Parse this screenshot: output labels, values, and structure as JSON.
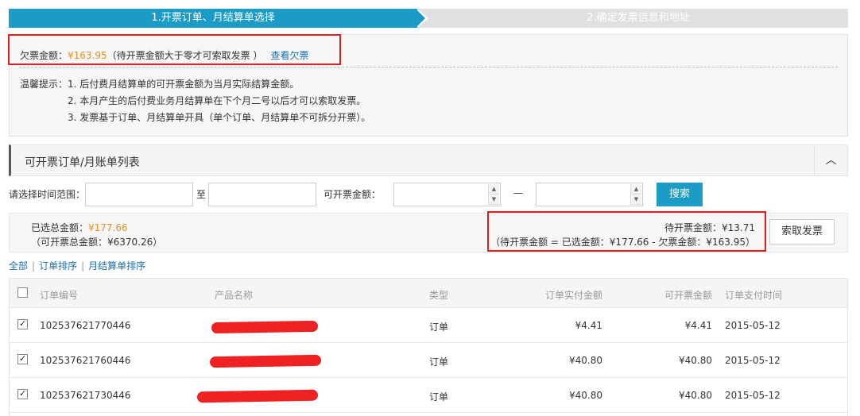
{
  "steps": {
    "active": "1.开票订单、月结算单选择",
    "inactive": "2.确定发票信息和地址"
  },
  "notice": {
    "owed_label": "欠票金额：",
    "owed_amount": "¥163.95",
    "owed_note": "（待开票金额大于零才可索取发票 ）",
    "owed_link": "查看欠票",
    "tips_label": "温馨提示：",
    "tips": [
      "1. 后付费月结算单的可开票金额为当月实际结算金额。",
      "2. 本月产生的后付费业务月结算单在下个月二号以后才可以索取发票。",
      "3. 发票基于订单、月结算单开具（单个订单、月结算单不可拆分开票）。"
    ]
  },
  "section": {
    "title": "可开票订单/月账单列表",
    "collapse_icon": "chevron-up-icon"
  },
  "filters": {
    "time_label": "请选择时间范围：",
    "to_label": "至",
    "amount_label": "可开票金额：",
    "dash": "—",
    "search_button": "搜索"
  },
  "summary": {
    "selected_label": "已选总金额：",
    "selected_amount": "¥177.66",
    "total_invoiceable": "（可开票总金额：¥6370.26）",
    "pending_line": "待开票金额：¥13.71",
    "formula_line": "（待开票金额 = 已选金额：¥177.66 - 欠票金额：¥163.95）",
    "request_button": "索取发票"
  },
  "sort_links": [
    "全部",
    "订单排序",
    "月结算单排序"
  ],
  "table": {
    "headers": [
      "订单编号",
      "产品名称",
      "类型",
      "订单实付金额",
      "可开票金额",
      "订单支付时间"
    ],
    "rows": [
      {
        "id": "102537621770446",
        "type": "订单",
        "paid": "¥4.41",
        "invoiceable": "¥4.41",
        "time": "2015-05-12",
        "checked": true
      },
      {
        "id": "102537621760446",
        "type": "订单",
        "paid": "¥40.80",
        "invoiceable": "¥40.80",
        "time": "2015-05-12",
        "checked": true
      },
      {
        "id": "102537621730446",
        "type": "订单",
        "paid": "¥40.80",
        "invoiceable": "¥40.80",
        "time": "2015-05-12",
        "checked": true
      }
    ]
  },
  "colors": {
    "accent": "#1a9cc6",
    "amount": "#e5901e",
    "highlight_border": "#e02020",
    "link": "#1a6fb0"
  }
}
